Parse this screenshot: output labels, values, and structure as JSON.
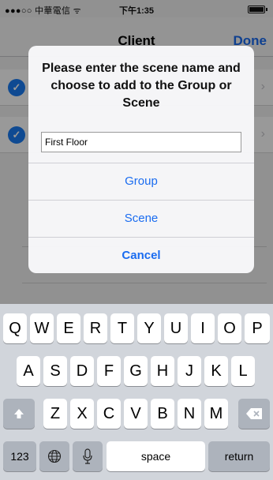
{
  "status_bar": {
    "carrier": "●●●○○ 中華電信 ᯤ",
    "time": "下午1:35"
  },
  "navbar": {
    "title": "Client",
    "done_label": "Done"
  },
  "alert": {
    "message": "Please enter the scene name and choose to add to the Group or Scene",
    "input_value": "First Floor",
    "buttons": {
      "group": "Group",
      "scene": "Scene",
      "cancel": "Cancel"
    }
  },
  "keyboard": {
    "row1": [
      "Q",
      "W",
      "E",
      "R",
      "T",
      "Y",
      "U",
      "I",
      "O",
      "P"
    ],
    "row2": [
      "A",
      "S",
      "D",
      "F",
      "G",
      "H",
      "J",
      "K",
      "L"
    ],
    "row3": [
      "Z",
      "X",
      "C",
      "V",
      "B",
      "N",
      "M"
    ],
    "numbers_label": "123",
    "space_label": "space",
    "return_label": "return",
    "icons": {
      "shift": "shift-icon",
      "backspace": "backspace-icon",
      "globe": "globe-icon",
      "mic": "microphone-icon"
    }
  }
}
